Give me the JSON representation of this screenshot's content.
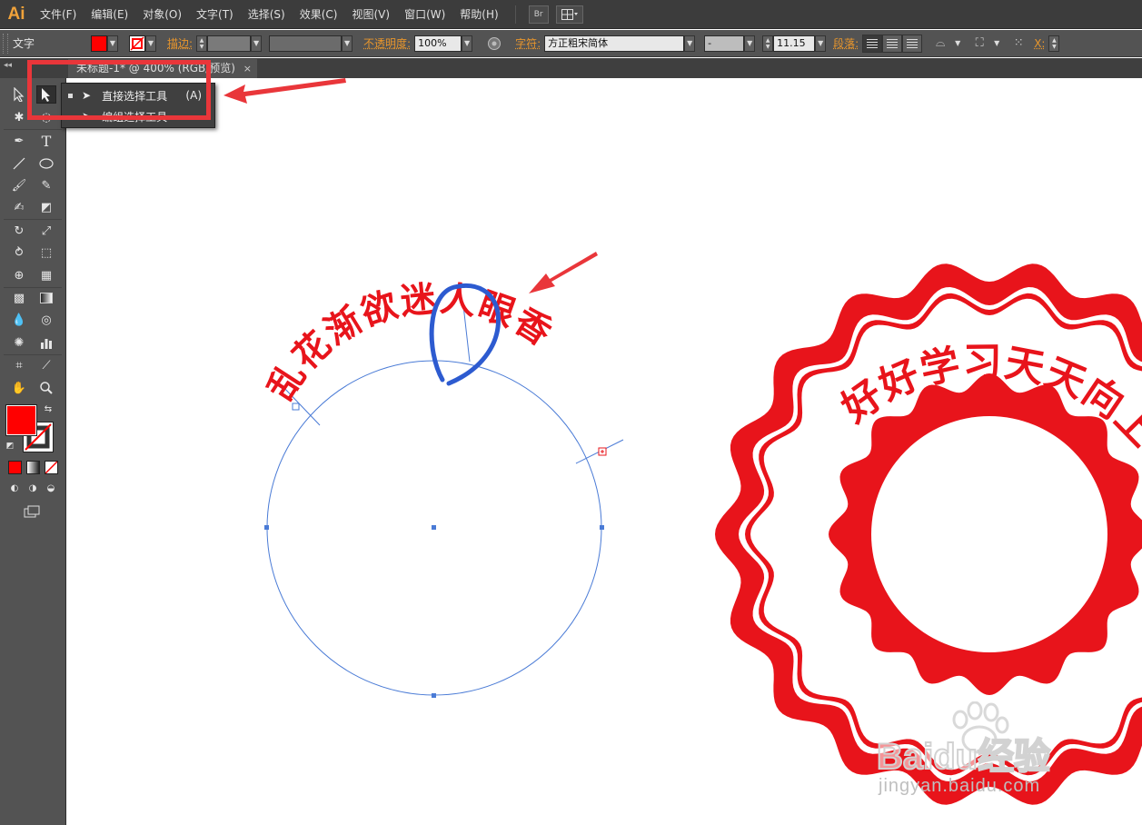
{
  "app": {
    "logo": "Ai"
  },
  "menubar": {
    "items": [
      "文件(F)",
      "编辑(E)",
      "对象(O)",
      "文字(T)",
      "选择(S)",
      "效果(C)",
      "视图(V)",
      "窗口(W)",
      "帮助(H)"
    ],
    "bridge_button": "Br"
  },
  "controlbar": {
    "tool_label": "文字",
    "stroke_label": "描边:",
    "opacity_label": "不透明度:",
    "opacity_value": "100%",
    "character_label": "字符:",
    "font_family": "方正粗宋简体",
    "font_style": "-",
    "font_size": "11.15",
    "paragraph_label": "段落:",
    "x_label": "X:",
    "fill_color": "#ff0000"
  },
  "document_tab": {
    "title": "未标题-1* @ 400% (RGB/预览)",
    "close": "×"
  },
  "flyout": {
    "item1_label": "直接选择工具",
    "item1_shortcut": "(A)",
    "item2_label": "编组选择工具"
  },
  "artwork": {
    "arc_text": "乱花渐欲迷人眼香",
    "seal_text": "好好学习天天向上",
    "text_color": "#e8141b",
    "path_color": "#4a7bd6",
    "annotation_color": "#2d5bd0",
    "arrow_color": "#e9363a"
  },
  "watermark": {
    "brand": "Baidu经验",
    "url": "jingyan.baidu.com"
  }
}
